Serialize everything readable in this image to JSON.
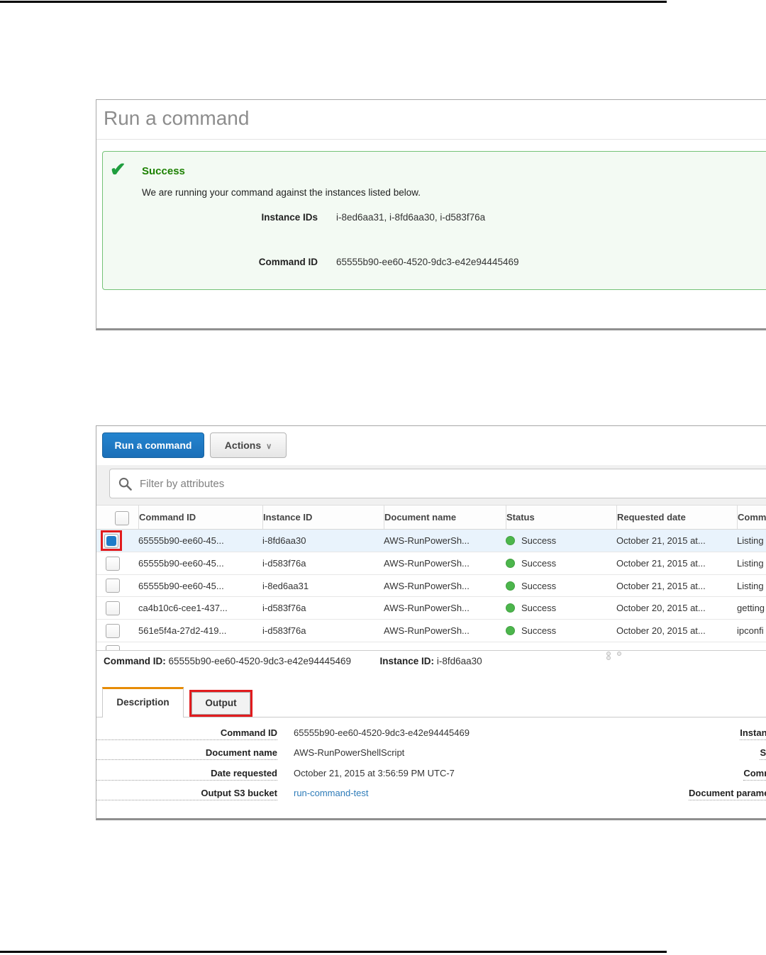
{
  "screenshot1": {
    "title": "Run a command",
    "alert": {
      "icon": "checkmark-icon",
      "title": "Success",
      "message": "We are running your command against the instances listed below.",
      "fields": [
        {
          "label": "Instance IDs",
          "value": "i-8ed6aa31, i-8fd6aa30, i-d583f76a"
        },
        {
          "label": "Command ID",
          "value": "65555b90-ee60-4520-9dc3-e42e94445469"
        }
      ]
    }
  },
  "screenshot2": {
    "toolbar": {
      "run_button_label": "Run a command",
      "actions_button_label": "Actions",
      "actions_chevron": "∨"
    },
    "filter_placeholder": "Filter by attributes",
    "table": {
      "headers": [
        "Command ID",
        "Instance ID",
        "Document name",
        "Status",
        "Requested date",
        "Comm"
      ],
      "rows": [
        {
          "command_id": "65555b90-ee60-45...",
          "instance_id": "i-8fd6aa30",
          "document_name": "AWS-RunPowerSh...",
          "status": "Success",
          "requested_date": "October 21, 2015 at...",
          "comment": "Listing",
          "selected": true
        },
        {
          "command_id": "65555b90-ee60-45...",
          "instance_id": "i-d583f76a",
          "document_name": "AWS-RunPowerSh...",
          "status": "Success",
          "requested_date": "October 21, 2015 at...",
          "comment": "Listing",
          "selected": false
        },
        {
          "command_id": "65555b90-ee60-45...",
          "instance_id": "i-8ed6aa31",
          "document_name": "AWS-RunPowerSh...",
          "status": "Success",
          "requested_date": "October 21, 2015 at...",
          "comment": "Listing",
          "selected": false
        },
        {
          "command_id": "ca4b10c6-cee1-437...",
          "instance_id": "i-d583f76a",
          "document_name": "AWS-RunPowerSh...",
          "status": "Success",
          "requested_date": "October 20, 2015 at...",
          "comment": "getting",
          "selected": false
        },
        {
          "command_id": "561e5f4a-27d2-419...",
          "instance_id": "i-d583f76a",
          "document_name": "AWS-RunPowerSh...",
          "status": "Success",
          "requested_date": "October 20, 2015 at...",
          "comment": "ipconfi",
          "selected": false
        }
      ]
    },
    "selection_summary": {
      "command_id_label": "Command ID:",
      "command_id_value": "65555b90-ee60-4520-9dc3-e42e94445469",
      "instance_id_label": "Instance ID:",
      "instance_id_value": "i-8fd6aa30"
    },
    "tabs": {
      "description": "Description",
      "output": "Output"
    },
    "details": {
      "left": [
        {
          "label": "Command ID",
          "value": "65555b90-ee60-4520-9dc3-e42e94445469"
        },
        {
          "label": "Document name",
          "value": "AWS-RunPowerShellScript"
        },
        {
          "label": "Date requested",
          "value": "October 21, 2015 at 3:56:59 PM UTC-7"
        },
        {
          "label": "Output S3 bucket",
          "value": "run-command-test"
        }
      ],
      "right_labels": [
        "Instance",
        "Stat",
        "Comme",
        "Document paramete"
      ]
    }
  },
  "colors": {
    "primary_button_blue": "#1e7bc8",
    "success_green_text": "#1d8102",
    "success_check_green": "#1f9e3e",
    "alert_background": "#f3faf3",
    "alert_border": "#74c277",
    "status_dot_green": "#4cb64c",
    "active_tab_accent_orange": "#e78c06",
    "annotation_red": "#e11b1e",
    "link_blue": "#2e7cb9",
    "selected_row_blue": "#e9f3fc"
  }
}
